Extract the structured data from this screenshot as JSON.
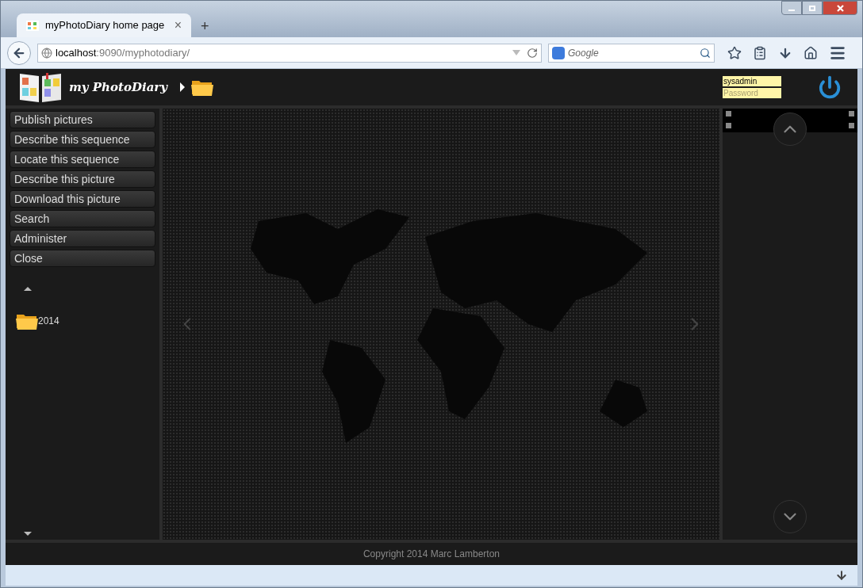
{
  "browser": {
    "tab": {
      "title": "myPhotoDiary home page",
      "close": "×",
      "new_tab": "+"
    },
    "address": {
      "host": "localhost",
      "path": ":9090/myphotodiary/"
    },
    "search": {
      "placeholder": "Google"
    }
  },
  "header": {
    "brand": "my PhotoDiary",
    "login": {
      "username": "sysadmin",
      "password_placeholder": "Password"
    }
  },
  "menu": [
    {
      "label": "Publish pictures"
    },
    {
      "label": "Describe this sequence"
    },
    {
      "label": "Locate this sequence"
    },
    {
      "label": "Describe this picture"
    },
    {
      "label": "Download this picture"
    },
    {
      "label": "Search"
    },
    {
      "label": "Administer"
    },
    {
      "label": "Close"
    }
  ],
  "folders": [
    {
      "label": "2014"
    }
  ],
  "footer": {
    "copyright": "Copyright 2014 Marc Lamberton"
  }
}
